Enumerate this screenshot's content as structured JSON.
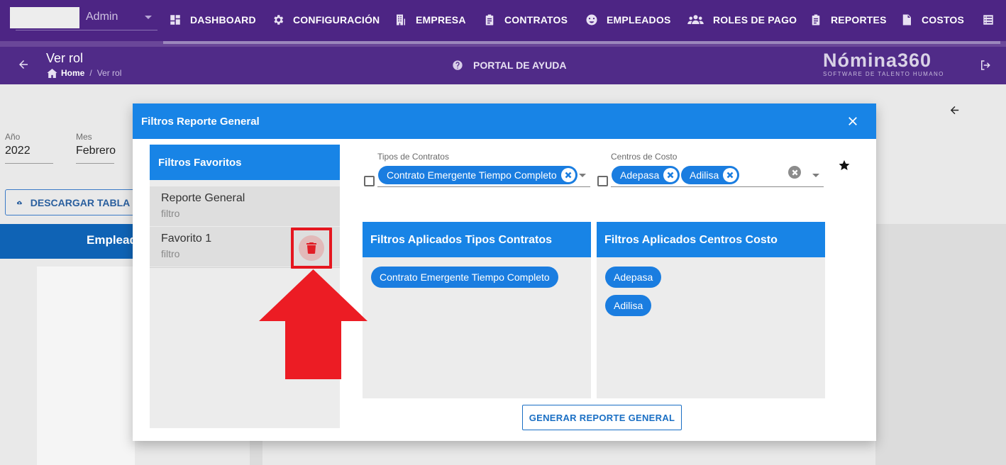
{
  "nav": {
    "user_role": "Admin",
    "items": [
      {
        "label": "DASHBOARD",
        "icon": "dashboard-icon"
      },
      {
        "label": "CONFIGURACIÓN",
        "icon": "gear-icon"
      },
      {
        "label": "EMPRESA",
        "icon": "building-icon"
      },
      {
        "label": "CONTRATOS",
        "icon": "clipboard-icon"
      },
      {
        "label": "EMPLEADOS",
        "icon": "face-icon"
      },
      {
        "label": "ROLES DE PAGO",
        "icon": "people-icon"
      },
      {
        "label": "REPORTES",
        "icon": "clipboard-icon"
      },
      {
        "label": "COSTOS",
        "icon": "file-dollar-icon"
      }
    ]
  },
  "header": {
    "title": "Ver rol",
    "breadcrumb": {
      "home": "Home",
      "current": "Ver rol"
    },
    "help": "PORTAL DE AYUDA",
    "brand_name": "Nómina360",
    "brand_tagline": "SOFTWARE DE TALENTO HUMANO"
  },
  "background": {
    "year_label": "Año",
    "year_value": "2022",
    "month_label": "Mes",
    "month_value": "Febrero",
    "download_label": "DESCARGAR TABLA E",
    "employees_label": "Empleados"
  },
  "dialog": {
    "title": "Filtros Reporte General",
    "favorites": {
      "title": "Filtros Favoritos",
      "items": [
        {
          "title": "Reporte General",
          "subtitle": "filtro"
        },
        {
          "title": "Favorito 1",
          "subtitle": "filtro"
        }
      ]
    },
    "contract_types": {
      "label": "Tipos de Contratos",
      "selected": [
        "Contrato Emergente Tiempo Completo"
      ]
    },
    "cost_centers": {
      "label": "Centros de Costo",
      "selected": [
        "Adepasa",
        "Adilisa"
      ]
    },
    "applied_contracts": {
      "title": "Filtros Aplicados Tipos Contratos",
      "chips": [
        "Contrato Emergente Tiempo Completo"
      ]
    },
    "applied_costs": {
      "title": "Filtros Aplicados Centros Costo",
      "chips": [
        "Adepasa",
        "Adilisa"
      ]
    },
    "generate_label": "GENERAR REPORTE GENERAL"
  },
  "colors": {
    "nav_bg": "#4d2584",
    "header_bg": "#502b88",
    "primary_blue": "#1884e6",
    "chip_blue": "#1a7de0",
    "highlight_red": "#e5161f"
  }
}
